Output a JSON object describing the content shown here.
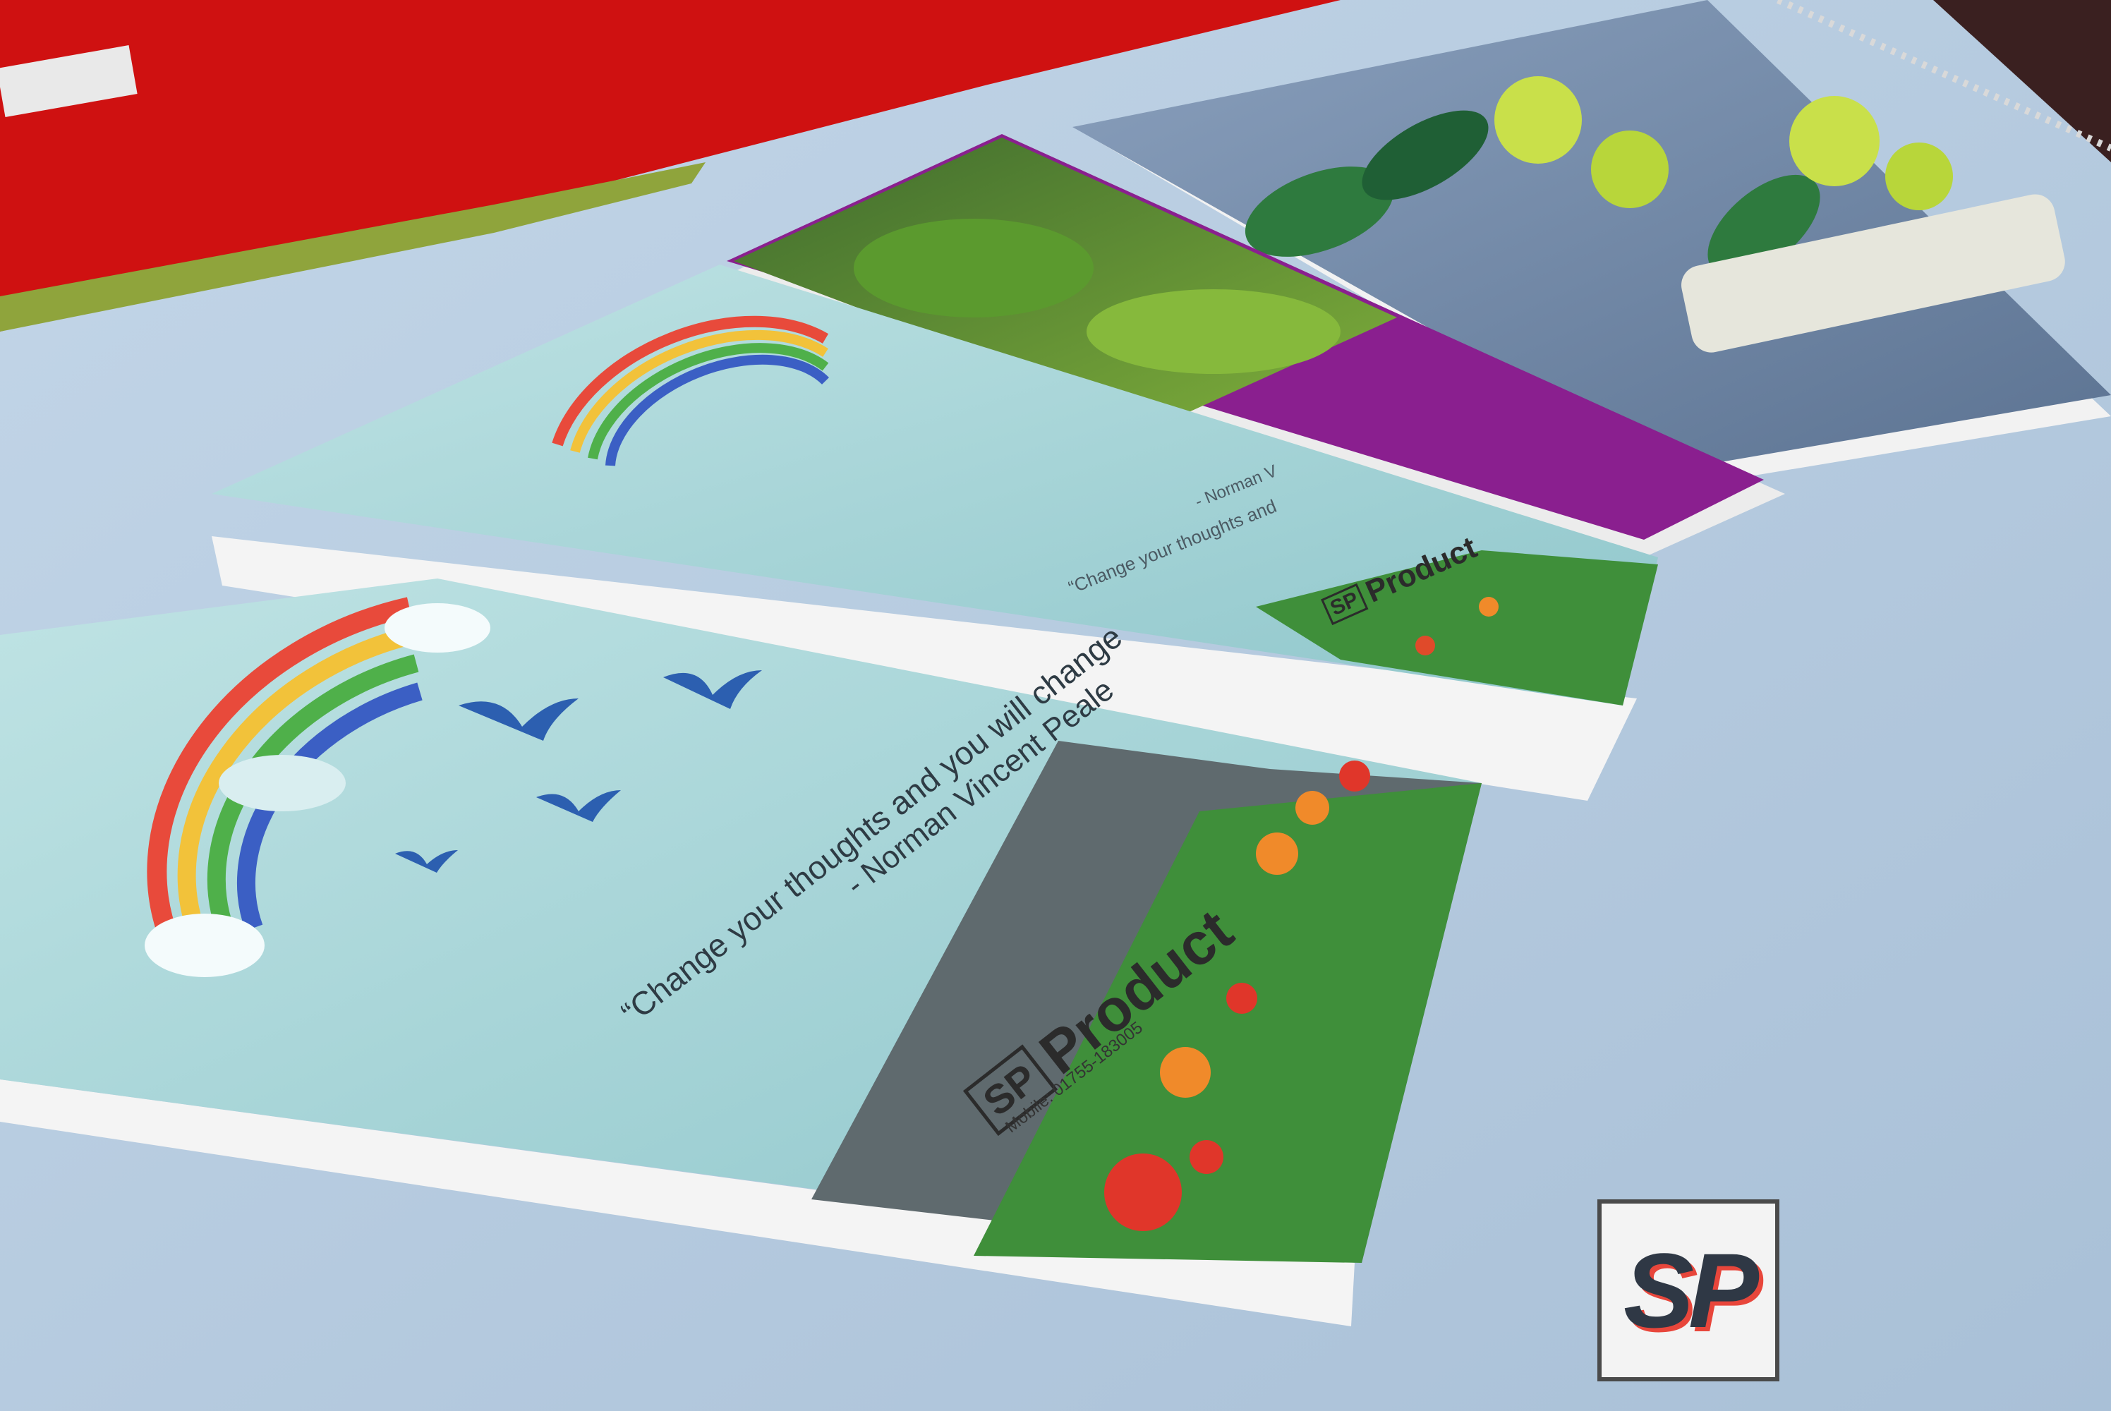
{
  "cover_quote": "“Change your thoughts and you will change",
  "cover_author": "- Norman Vincent Peale",
  "back_quote": "“Change your thoughts and",
  "back_author": "- Norman V",
  "brand_box": "SP",
  "brand_word": "Product",
  "contact_line": "Mobile: 01755-183005",
  "watermark": "SP",
  "colors": {
    "blanket": "#b8cde0",
    "red_cloth": "#d01010",
    "sky": "#a9d6d8",
    "purple_cover": "#8a1f8f",
    "slate_cover": "#6f86a6",
    "flower_orange": "#f08a2a",
    "leaf_yellow": "#c9e04a"
  }
}
